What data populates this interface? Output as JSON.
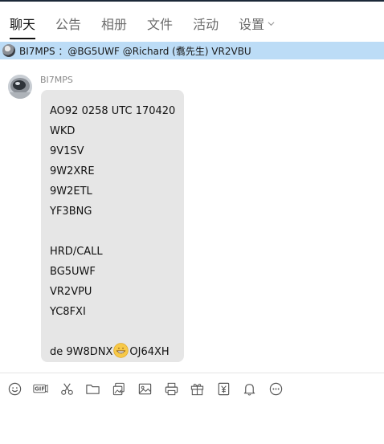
{
  "tabs": [
    {
      "label": "聊天",
      "active": true
    },
    {
      "label": "公告",
      "active": false
    },
    {
      "label": "相册",
      "active": false
    },
    {
      "label": "文件",
      "active": false
    },
    {
      "label": "活动",
      "active": false
    },
    {
      "label": "设置",
      "active": false,
      "dropdown": true
    }
  ],
  "banner": {
    "text": "BI7MPS ：@BG5UWF @Richard (翥先生) VR2VBU",
    "bg_color": "#bcdcf6"
  },
  "message": {
    "sender": "BI7MPS",
    "lines": [
      "AO92 0258 UTC 170420",
      "WKD",
      "9V1SV",
      "9W2XRE",
      "9W2ETL",
      "YF3BNG",
      "",
      "HRD/CALL",
      "BG5UWF",
      "VR2VPU",
      "YC8FXI",
      "",
      "de 9W8DNX",
      "OJ64XH"
    ],
    "emoji": "grinning-face-emoji",
    "bubble_color": "#e6e6e6"
  },
  "toolbar": {
    "icons": [
      "smiley-icon",
      "gif-icon",
      "scissors-icon",
      "folder-icon",
      "image-files-icon",
      "picture-icon",
      "printer-icon",
      "gift-icon",
      "vote-icon",
      "bell-icon",
      "more-icon"
    ],
    "gif_label": "GIF"
  }
}
